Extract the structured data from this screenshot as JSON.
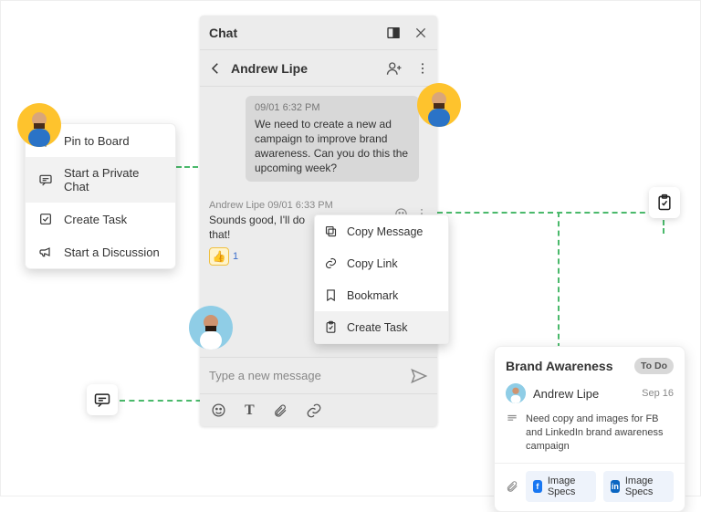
{
  "left_menu": {
    "pin": "Pin to Board",
    "chat": "Start a Private Chat",
    "task": "Create Task",
    "discuss": "Start a Discussion"
  },
  "chat": {
    "title": "Chat",
    "contact": "Andrew Lipe",
    "msg1_ts": "09/01 6:32 PM",
    "msg1_text": "We need to create a new ad campaign to improve brand awareness. Can you do this the upcoming week?",
    "msg2_meta": "Andrew Lipe  09/01 6:33 PM",
    "msg2_text": "Sounds good, I'll do that!",
    "reaction_count": "1",
    "input_placeholder": "Type a new message"
  },
  "context_menu": {
    "copy_msg": "Copy Message",
    "copy_link": "Copy Link",
    "bookmark": "Bookmark",
    "create_task": "Create Task"
  },
  "task": {
    "title": "Brand Awareness",
    "status": "To Do",
    "assignee": "Andrew Lipe",
    "due": "Sep 16",
    "desc": "Need copy and images for FB and LinkedIn brand awareness campaign",
    "chip1": "Image Specs",
    "chip2": "Image Specs"
  }
}
